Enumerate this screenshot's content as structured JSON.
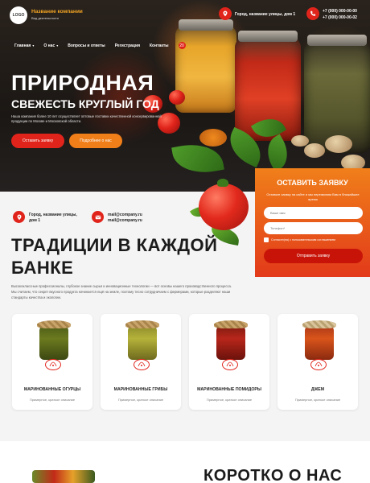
{
  "header": {
    "logo": "LOGO",
    "company_name": "Название компании",
    "company_desc": "Вид деятельности",
    "address": "Город, название улицы, дом 1",
    "phones": [
      "+7 (000) 000-00-00",
      "+7 (000) 000-00-02"
    ]
  },
  "nav": {
    "items": [
      "Главная",
      "О нас",
      "Вопросы и ответы",
      "Регистрация",
      "Контакты"
    ],
    "badge": "20"
  },
  "hero": {
    "title_line1": "ПРИРОДНАЯ",
    "title_line2": "СВЕЖЕСТЬ КРУГЛЫЙ ГОД",
    "description": "Наша компания более 10 лет осуществляет оптовые поставки качественной консервированной продукции по Москве и Московской области.",
    "primary_button": "Оставить заявку",
    "secondary_button": "Подробнее о нас"
  },
  "form": {
    "title": "ОСТАВИТЬ ЗАЯВКУ",
    "subtitle": "Оставьте заявку на сайте и мы перезвоним Вам в ближайшее время",
    "name_placeholder": "Ваше имя",
    "phone_placeholder": "Телефон*",
    "consent": "Согласен(на) с пользовательским соглашением",
    "submit": "Отправить заявку"
  },
  "contacts": {
    "address_line1": "Город, название улицы,",
    "address_line2": "дом 1",
    "email1": "mail@company.ru",
    "email2": "mail@company.ru"
  },
  "traditions": {
    "title_line1": "ТРАДИЦИИ В КАЖДОЙ",
    "title_line2": "БАНКЕ",
    "description": "Высококлассные профессионалы, глубокое знание сырья и инновационные технологии — вот основы нашего производственного процесса. Мы считаем, что секрет вкусного продукта начинается ещё на земле, поэтому тесно сотрудничаем с фермерами, которые разделяют наши стандарты качества и экологии."
  },
  "products": [
    {
      "name": "МАРИНОВАННЫЕ ОГУРЦЫ",
      "desc": "Примерное, краткое описание",
      "color": "#6b7a1e"
    },
    {
      "name": "МАРИНОВАННЫЕ ГРИБЫ",
      "desc": "Примерное, краткое описание",
      "color": "#b5b23a"
    },
    {
      "name": "МАРИНОВАННЫЕ ПОМИДОРЫ",
      "desc": "Примерное, краткое описание",
      "color": "#b8261a"
    },
    {
      "name": "ДЖЕМ",
      "desc": "Примерное, краткое описание",
      "color": "#d9541a"
    }
  ],
  "about": {
    "title": "КОРОТКО О НАС"
  },
  "colors": {
    "accent_red": "#e0241b",
    "accent_orange": "#f07f1a",
    "brand_gold": "#f5a623"
  }
}
